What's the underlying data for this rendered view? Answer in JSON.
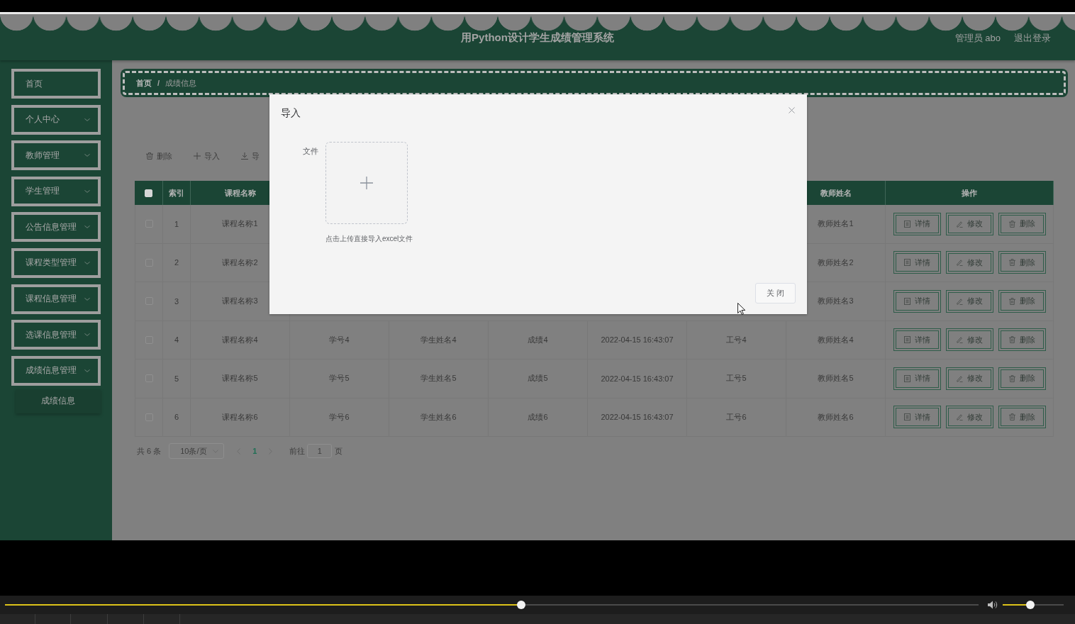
{
  "header": {
    "title": "用Python设计学生成绩管理系统",
    "user": "管理员 abo",
    "logout": "退出登录"
  },
  "sidebar": {
    "items": [
      {
        "kind": "link",
        "label": "首页"
      },
      {
        "kind": "menu",
        "label": "个人中心"
      },
      {
        "kind": "menu",
        "label": "教师管理"
      },
      {
        "kind": "menu",
        "label": "学生管理"
      },
      {
        "kind": "menu",
        "label": "公告信息管理"
      },
      {
        "kind": "menu",
        "label": "课程类型管理"
      },
      {
        "kind": "menu",
        "label": "课程信息管理"
      },
      {
        "kind": "menu",
        "label": "选课信息管理"
      },
      {
        "kind": "menu",
        "label": "成绩信息管理",
        "children": [
          {
            "label": "成绩信息"
          }
        ]
      }
    ]
  },
  "breadcrumb": {
    "items": [
      "首页",
      "成绩信息"
    ],
    "separator": "/"
  },
  "toolbar": [
    {
      "kind": "delete",
      "label": "删除"
    },
    {
      "kind": "import",
      "label": "导入"
    },
    {
      "kind": "export",
      "label": "导"
    }
  ],
  "table": {
    "columns": [
      {
        "kind": "checkbox",
        "checked": false
      },
      {
        "kind": "label",
        "label": "索引"
      },
      {
        "kind": "label",
        "label": "课程名称"
      },
      {
        "kind": "blank"
      },
      {
        "kind": "blank"
      },
      {
        "kind": "blank"
      },
      {
        "kind": "blank"
      },
      {
        "kind": "blank"
      },
      {
        "kind": "label",
        "label": "教师姓名"
      },
      {
        "kind": "label",
        "label": "操作"
      }
    ],
    "rows": [
      {
        "selected": false,
        "cells": [
          {
            "kind": "checkbox"
          },
          {
            "kind": "text",
            "text": "1"
          },
          {
            "kind": "text",
            "text": "课程名称1"
          },
          {
            "kind": "blank"
          },
          {
            "kind": "blank"
          },
          {
            "kind": "blank"
          },
          {
            "kind": "blank"
          },
          {
            "kind": "blank"
          },
          {
            "kind": "text",
            "text": "教师姓名1"
          },
          {
            "kind": "actions",
            "buttons": [
              {
                "kind": "detail",
                "label": "详情"
              },
              {
                "kind": "edit",
                "label": "修改"
              },
              {
                "kind": "delete",
                "label": "删除"
              }
            ]
          }
        ]
      },
      {
        "selected": false,
        "cells": [
          {
            "kind": "checkbox"
          },
          {
            "kind": "text",
            "text": "2"
          },
          {
            "kind": "text",
            "text": "课程名称2"
          },
          {
            "kind": "blank"
          },
          {
            "kind": "blank"
          },
          {
            "kind": "blank"
          },
          {
            "kind": "blank"
          },
          {
            "kind": "blank"
          },
          {
            "kind": "text",
            "text": "教师姓名2"
          },
          {
            "kind": "actions",
            "buttons": [
              {
                "kind": "detail",
                "label": "详情"
              },
              {
                "kind": "edit",
                "label": "修改"
              },
              {
                "kind": "delete",
                "label": "删除"
              }
            ]
          }
        ]
      },
      {
        "selected": false,
        "cells": [
          {
            "kind": "checkbox"
          },
          {
            "kind": "text",
            "text": "3"
          },
          {
            "kind": "text",
            "text": "课程名称3"
          },
          {
            "kind": "blank"
          },
          {
            "kind": "blank"
          },
          {
            "kind": "blank"
          },
          {
            "kind": "blank"
          },
          {
            "kind": "blank"
          },
          {
            "kind": "text",
            "text": "教师姓名3"
          },
          {
            "kind": "actions",
            "buttons": [
              {
                "kind": "detail",
                "label": "详情"
              },
              {
                "kind": "edit",
                "label": "修改"
              },
              {
                "kind": "delete",
                "label": "删除"
              }
            ]
          }
        ]
      },
      {
        "selected": false,
        "cells": [
          {
            "kind": "checkbox"
          },
          {
            "kind": "text",
            "text": "4"
          },
          {
            "kind": "text",
            "text": "课程名称4"
          },
          {
            "kind": "text",
            "text": "学号4"
          },
          {
            "kind": "text",
            "text": "学生姓名4"
          },
          {
            "kind": "text",
            "text": "成绩4"
          },
          {
            "kind": "text",
            "text": "2022-04-15 16:43:07"
          },
          {
            "kind": "text",
            "text": "工号4"
          },
          {
            "kind": "text",
            "text": "教师姓名4"
          },
          {
            "kind": "actions",
            "buttons": [
              {
                "kind": "detail",
                "label": "详情"
              },
              {
                "kind": "edit",
                "label": "修改"
              },
              {
                "kind": "delete",
                "label": "删除"
              }
            ]
          }
        ]
      },
      {
        "selected": false,
        "cells": [
          {
            "kind": "checkbox"
          },
          {
            "kind": "text",
            "text": "5"
          },
          {
            "kind": "text",
            "text": "课程名称5"
          },
          {
            "kind": "text",
            "text": "学号5"
          },
          {
            "kind": "text",
            "text": "学生姓名5"
          },
          {
            "kind": "text",
            "text": "成绩5"
          },
          {
            "kind": "text",
            "text": "2022-04-15 16:43:07"
          },
          {
            "kind": "text",
            "text": "工号5"
          },
          {
            "kind": "text",
            "text": "教师姓名5"
          },
          {
            "kind": "actions",
            "buttons": [
              {
                "kind": "detail",
                "label": "详情"
              },
              {
                "kind": "edit",
                "label": "修改"
              },
              {
                "kind": "delete",
                "label": "删除"
              }
            ]
          }
        ]
      },
      {
        "selected": false,
        "cells": [
          {
            "kind": "checkbox"
          },
          {
            "kind": "text",
            "text": "6"
          },
          {
            "kind": "text",
            "text": "课程名称6"
          },
          {
            "kind": "text",
            "text": "学号6"
          },
          {
            "kind": "text",
            "text": "学生姓名6"
          },
          {
            "kind": "text",
            "text": "成绩6"
          },
          {
            "kind": "text",
            "text": "2022-04-15 16:43:07"
          },
          {
            "kind": "text",
            "text": "工号6"
          },
          {
            "kind": "text",
            "text": "教师姓名6"
          },
          {
            "kind": "actions",
            "buttons": [
              {
                "kind": "detail",
                "label": "详情"
              },
              {
                "kind": "edit",
                "label": "修改"
              },
              {
                "kind": "delete",
                "label": "删除"
              }
            ]
          }
        ]
      }
    ]
  },
  "pagination": {
    "total": "共 6 条",
    "page_size": "10条/页",
    "pages": [
      {
        "label": "1",
        "selected": true
      }
    ],
    "goto_label": "前往",
    "goto_value": "1",
    "goto_unit": "页"
  },
  "modal": {
    "title": "导入",
    "field_label": "文件",
    "upload_hint": "点击上传直接导入excel文件",
    "close_button": "关 闭"
  },
  "player": {
    "progress": {
      "level": 0.53
    },
    "volume": {
      "level": 0.45
    }
  }
}
